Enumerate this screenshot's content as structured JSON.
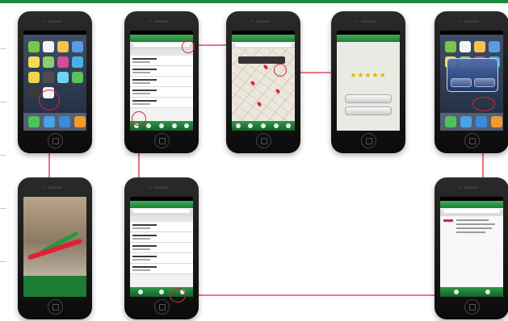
{
  "diagram": {
    "accent_color": "#1d8a3a",
    "connector_color": "#d9283e",
    "screens": [
      {
        "id": "home-screen",
        "icon": "app-launch"
      },
      {
        "id": "category-list",
        "icon": "list"
      },
      {
        "id": "map-view",
        "icon": "map"
      },
      {
        "id": "rating",
        "icon": "stars"
      },
      {
        "id": "exit-alert",
        "icon": "dialog"
      },
      {
        "id": "splash",
        "icon": "logo"
      },
      {
        "id": "supermarket-list",
        "icon": "list"
      },
      {
        "id": "news",
        "icon": "news"
      }
    ]
  }
}
